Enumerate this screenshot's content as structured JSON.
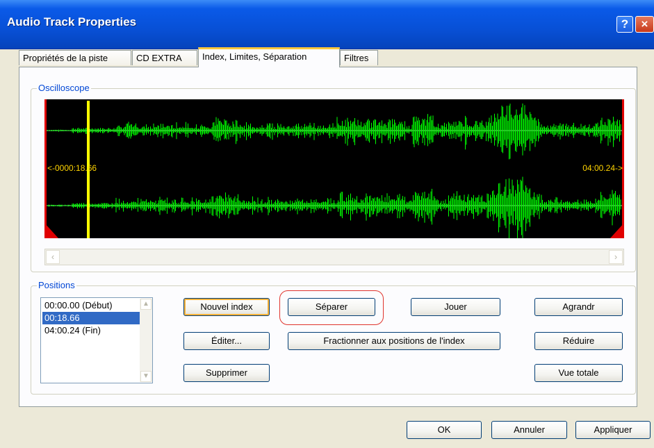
{
  "window": {
    "title": "Audio Track Properties"
  },
  "titlebar": {
    "help_glyph": "?",
    "close_glyph": "×"
  },
  "tabs": [
    {
      "label": "Propriétés de la piste"
    },
    {
      "label": "CD EXTRA"
    },
    {
      "label": "Index, Limites, Séparation",
      "active": true
    },
    {
      "label": "Filtres"
    }
  ],
  "oscilloscope": {
    "label": "Oscilloscope",
    "left_marker": "<-0000:18.66",
    "right_marker": "04:00.24->",
    "colors": {
      "background": "#000000",
      "wave": "#00FF00",
      "cursor": "#FFFF00",
      "marker_text": "#FFD400",
      "edge": "#FF0000"
    }
  },
  "positions": {
    "label": "Positions",
    "items": [
      {
        "label": "00:00.00 (Début)",
        "selected": false
      },
      {
        "label": "00:18.66",
        "selected": true
      },
      {
        "label": "04:00.24 (Fin)",
        "selected": false
      }
    ]
  },
  "buttons": {
    "new_index": "Nouvel index",
    "edit": "Éditer...",
    "delete": "Supprimer",
    "split": "Séparer",
    "split_at_index": "Fractionner aux positions de l'index",
    "play": "Jouer",
    "zoom_in": "Agrandr",
    "zoom_out": "Réduire",
    "full_view": "Vue totale"
  },
  "dialog_buttons": {
    "ok": "OK",
    "cancel": "Annuler",
    "apply": "Appliquer"
  },
  "accent_colors": {
    "highlight": "#E0332C",
    "selection": "#316AC5",
    "group_label": "#0046D5"
  }
}
